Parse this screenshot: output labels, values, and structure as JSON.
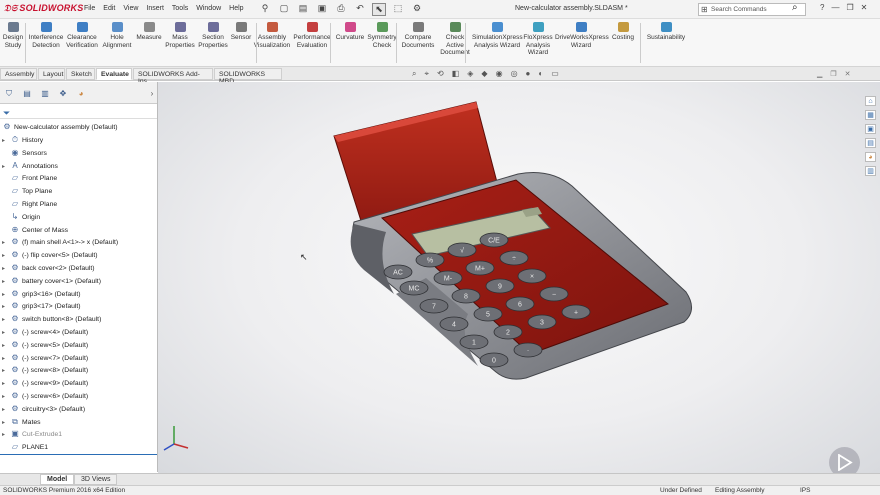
{
  "app": {
    "logo_text": "SOLIDWORKS",
    "menu": [
      "File",
      "Edit",
      "View",
      "Insert",
      "Tools",
      "Window",
      "Help"
    ],
    "doc_title": "New-calculator assembly.SLDASM *",
    "search_placeholder": "Search Commands"
  },
  "ribbon": [
    {
      "label": "Design Study",
      "icon": "design-study-icon",
      "color": "#6b7a8f"
    },
    {
      "label": "Interference Detection",
      "icon": "interference-icon",
      "color": "#3f7fc4"
    },
    {
      "label": "Clearance Verification",
      "icon": "clearance-icon",
      "color": "#3f7fc4"
    },
    {
      "label": "Hole Alignment",
      "icon": "hole-alignment-icon",
      "color": "#5a8fc9"
    },
    {
      "label": "Measure",
      "icon": "measure-icon",
      "color": "#8a8a8a"
    },
    {
      "label": "Mass Properties",
      "icon": "mass-properties-icon",
      "color": "#6d6d9a"
    },
    {
      "label": "Section Properties",
      "icon": "section-properties-icon",
      "color": "#6d6d9a"
    },
    {
      "label": "Sensor",
      "icon": "sensor-icon",
      "color": "#7a7a7a"
    },
    {
      "label": "Assembly Visualization",
      "icon": "assembly-visualization-icon",
      "color": "#c45a3f"
    },
    {
      "label": "Performance Evaluation",
      "icon": "performance-icon",
      "color": "#c43f3f"
    },
    {
      "label": "Curvature",
      "icon": "curvature-icon",
      "color": "#d04a8a"
    },
    {
      "label": "Symmetry Check",
      "icon": "symmetry-icon",
      "color": "#5a9a5a"
    },
    {
      "label": "Compare Documents",
      "icon": "compare-documents-icon",
      "color": "#7a7a7a"
    },
    {
      "label": "Check Active Document",
      "icon": "check-document-icon",
      "color": "#5a8a5a"
    },
    {
      "label": "SimulationXpress Analysis Wizard",
      "icon": "simulation-icon",
      "color": "#4a8fd0"
    },
    {
      "label": "FloXpress Analysis Wizard",
      "icon": "floxpress-icon",
      "color": "#3fa0c0"
    },
    {
      "label": "DriveWorksXpress Wizard",
      "icon": "driveworks-icon",
      "color": "#3f7fc4"
    },
    {
      "label": "Costing",
      "icon": "costing-icon",
      "color": "#c49a3f"
    },
    {
      "label": "Sustainability",
      "icon": "sustainability-icon",
      "color": "#3f8fc4"
    }
  ],
  "command_tabs": [
    "Assembly",
    "Layout",
    "Sketch",
    "Evaluate",
    "SOLIDWORKS Add-Ins",
    "SOLIDWORKS MBD"
  ],
  "active_command_tab": "Evaluate",
  "tree": {
    "root": "New-calculator assembly  (Default)",
    "items": [
      {
        "label": "History",
        "icon": "history-icon",
        "arrow": true
      },
      {
        "label": "Sensors",
        "icon": "sensors-icon",
        "arrow": false
      },
      {
        "label": "Annotations",
        "icon": "annotations-icon",
        "arrow": true
      },
      {
        "label": "Front Plane",
        "icon": "plane-icon",
        "arrow": false
      },
      {
        "label": "Top Plane",
        "icon": "plane-icon",
        "arrow": false
      },
      {
        "label": "Right Plane",
        "icon": "plane-icon",
        "arrow": false
      },
      {
        "label": "Origin",
        "icon": "origin-icon",
        "arrow": false
      },
      {
        "label": "Center of Mass",
        "icon": "center-of-mass-icon",
        "arrow": false
      },
      {
        "label": "(f) main shell A<1>-> x (Default)",
        "icon": "part-icon",
        "arrow": true
      },
      {
        "label": "(-) flip cover<5> (Default)",
        "icon": "part-icon",
        "arrow": true
      },
      {
        "label": "back cover<2> (Default)",
        "icon": "part-icon",
        "arrow": true
      },
      {
        "label": "battery cover<1> (Default)",
        "icon": "part-icon",
        "arrow": true
      },
      {
        "label": "grip3<16> (Default)",
        "icon": "part-icon",
        "arrow": true
      },
      {
        "label": "grip3<17> (Default)",
        "icon": "part-icon",
        "arrow": true
      },
      {
        "label": "switch button<8> (Default)",
        "icon": "part-icon",
        "arrow": true
      },
      {
        "label": "(-) screw<4> (Default)",
        "icon": "part-icon",
        "arrow": true
      },
      {
        "label": "(-) screw<5> (Default)",
        "icon": "part-icon",
        "arrow": true
      },
      {
        "label": "(-) screw<7> (Default)",
        "icon": "part-icon",
        "arrow": true
      },
      {
        "label": "(-) screw<8> (Default)",
        "icon": "part-icon",
        "arrow": true
      },
      {
        "label": "(-) screw<9> (Default)",
        "icon": "part-icon",
        "arrow": true
      },
      {
        "label": "(-) screw<6> (Default)",
        "icon": "part-icon",
        "arrow": true
      },
      {
        "label": "circuitry<3> (Default)",
        "icon": "assembly-icon",
        "arrow": true
      },
      {
        "label": "Mates",
        "icon": "mates-icon",
        "arrow": true
      },
      {
        "label": "Cut-Extrude1",
        "icon": "cut-extrude-icon",
        "arrow": true,
        "dim": true
      },
      {
        "label": "PLANE1",
        "icon": "plane-icon",
        "arrow": false
      }
    ]
  },
  "calculator_keys": [
    "AC",
    "%",
    "√",
    "C/E",
    "MC",
    "M-",
    "M+",
    "÷",
    "7",
    "8",
    "9",
    "×",
    "4",
    "5",
    "6",
    "−",
    "1",
    "2",
    "3",
    "+",
    "0",
    "·"
  ],
  "bottom_tabs": [
    "Model",
    "3D Views"
  ],
  "active_bottom_tab": "Model",
  "status": {
    "edition": "SOLIDWORKS Premium 2016 x64 Edition",
    "state": "Under Defined",
    "mode": "Editing Assembly",
    "units": "IPS"
  },
  "colors": {
    "accent": "#2a6db5",
    "body_red": "#b02218",
    "shell_grey": "#8e9097",
    "key_grey": "#6d6f75"
  }
}
